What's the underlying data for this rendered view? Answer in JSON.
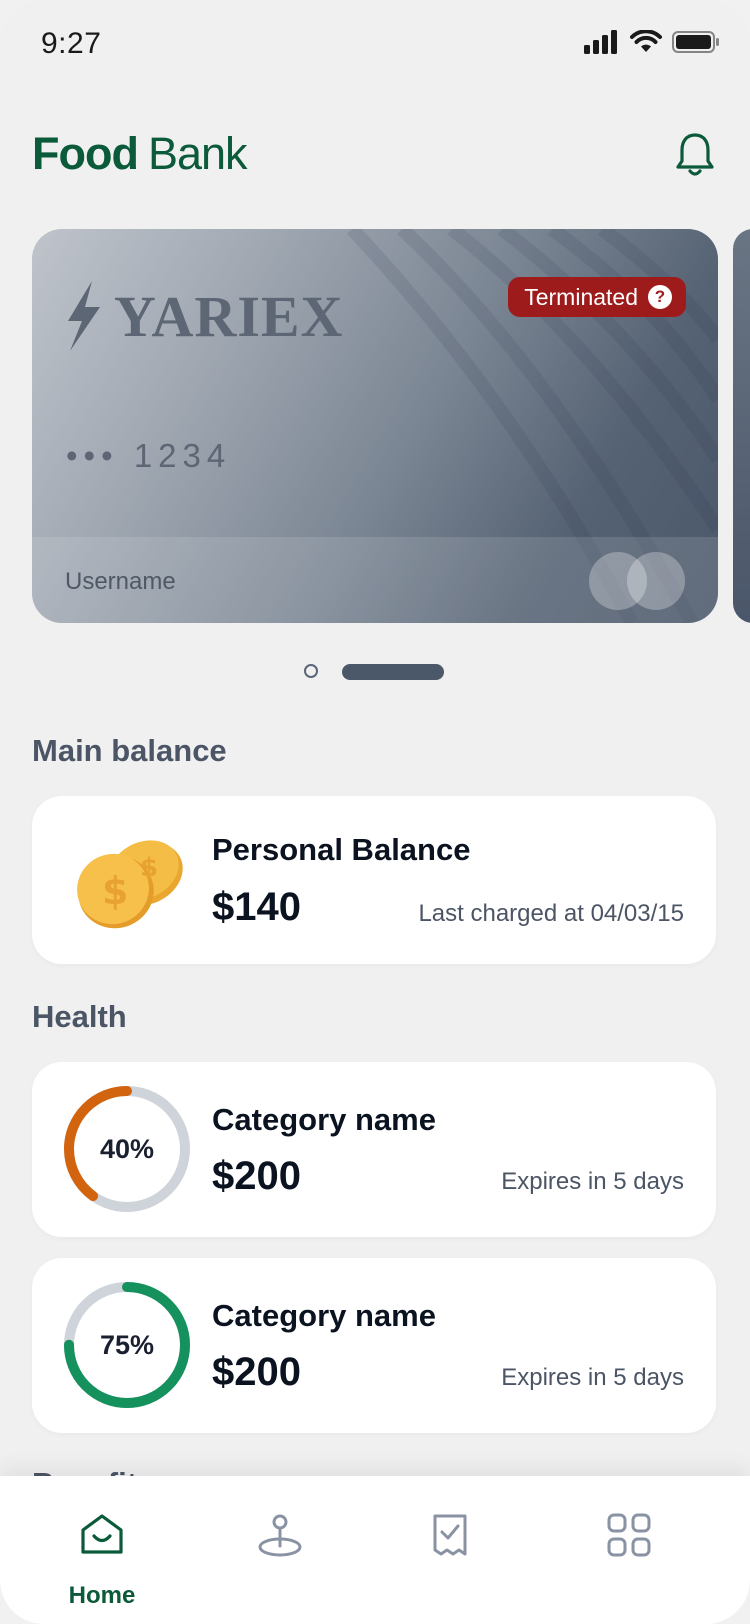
{
  "status_bar": {
    "time": "9:27"
  },
  "header": {
    "title_bold": "Food",
    "title_regular": "Bank"
  },
  "card": {
    "brand": "YARIEX",
    "number": "••• 1234",
    "holder": "Username",
    "status_badge": "Terminated",
    "status_help": "?",
    "status_color": "#9e1b1b"
  },
  "pager": {
    "count": 2,
    "active_index": 1
  },
  "main_balance": {
    "section_title": "Main balance",
    "title": "Personal Balance",
    "amount": "$140",
    "meta": "Last charged at 04/03/15"
  },
  "health": {
    "section_title": "Health",
    "items": [
      {
        "percent_label": "40%",
        "percent": 40,
        "color": "#d2640f",
        "title": "Category name",
        "amount": "$200",
        "meta": "Expires in 5 days"
      },
      {
        "percent_label": "75%",
        "percent": 75,
        "color": "#14915c",
        "title": "Category name",
        "amount": "$200",
        "meta": "Expires in 5 days"
      }
    ]
  },
  "next_section_peek": "Benefits",
  "tabbar": {
    "items": [
      {
        "icon": "home-icon",
        "label": "Home",
        "active": true
      },
      {
        "icon": "location-pin-icon",
        "label": ""
      },
      {
        "icon": "receipt-icon",
        "label": ""
      },
      {
        "icon": "grid-icon",
        "label": ""
      }
    ]
  },
  "colors": {
    "brand": "#0b5a3a",
    "card_dark": "#4b586a",
    "background": "#f0f0f1"
  }
}
